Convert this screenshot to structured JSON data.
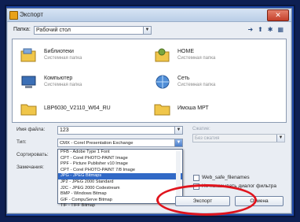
{
  "window": {
    "title": "Экспорт",
    "close_glyph": "✕"
  },
  "toolbar": {
    "folder_label": "Папка:",
    "folder_value": "Рабочий стол",
    "nav_icons": [
      "back-arrow-icon",
      "up-folder-icon",
      "new-folder-icon",
      "view-menu-icon"
    ]
  },
  "files": [
    {
      "name": "Библиотеки",
      "sub": "Системная папка",
      "icon": "libraries-icon"
    },
    {
      "name": "HOME",
      "sub": "Системная папка",
      "icon": "user-folder-icon"
    },
    {
      "name": "Компьютер",
      "sub": "Системная папка",
      "icon": "computer-icon"
    },
    {
      "name": "Сеть",
      "sub": "Системная папка",
      "icon": "network-icon"
    },
    {
      "name": "LBP6030_V2110_W64_RU",
      "sub": "",
      "icon": "folder-icon"
    },
    {
      "name": "Имоша МРТ",
      "sub": "",
      "icon": "folder-icon"
    }
  ],
  "form": {
    "filename_label": "Имя файла:",
    "filename_value": "123",
    "type_label": "Тип:",
    "type_value": "CMX - Corel Presentation Exchange",
    "sort_label": "Сортировать:",
    "notes_label": "Замечания:"
  },
  "type_options": [
    "PFB - Adobe Type 1 Font",
    "CPT - Corel PHOTO-PAINT Image",
    "PPF - Picture Publisher v10 Image",
    "CPT - Corel PHOTO-PAINT 7/8 Image",
    "JPG - JPEG Bitmaps",
    "JP2 - JPEG 2000 Standard",
    "J2C - JPEG 2000 Codestream",
    "BMP - Windows Bitmap",
    "GIF - CompuServe Bitmap",
    "TIF - TIFF Bitmap"
  ],
  "selected_option_index": 4,
  "right_panel": {
    "compression_label": "Сжатие:",
    "compression_value": "Без сжатия"
  },
  "options": {
    "web_safe_label": "Web_safe_filenames",
    "no_dialog_label": "Не показывать диалог фильтра"
  },
  "buttons": {
    "export": "Экспорт",
    "cancel": "Отмена"
  },
  "colors": {
    "highlight": "#3169c6",
    "annotation_ring": "#e0141d",
    "frame": "#1f4aa8"
  }
}
